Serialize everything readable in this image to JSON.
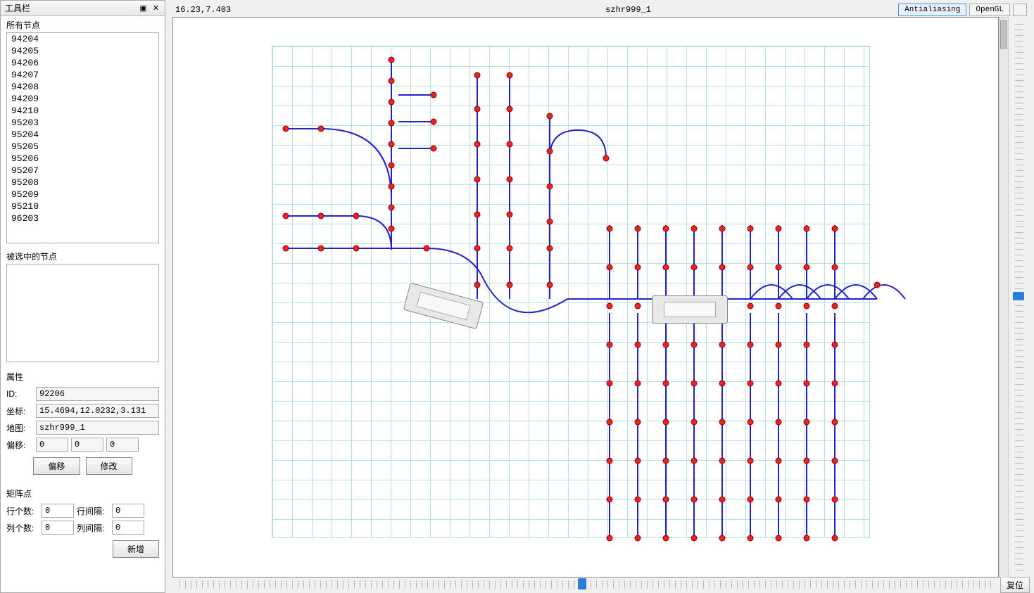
{
  "sidebar": {
    "title": "工具栏",
    "dock_icon": "▣",
    "close_icon": "✕",
    "all_nodes_label": "所有节点",
    "node_list": [
      "94204",
      "94205",
      "94206",
      "94207",
      "94208",
      "94209",
      "94210",
      "95203",
      "95204",
      "95205",
      "95206",
      "95207",
      "95208",
      "95209",
      "95210",
      "96203"
    ],
    "selected_label": "被选中的节点",
    "prop_label": "属性",
    "id_label": "ID:",
    "id_value": "92206",
    "coord_label": "坐标:",
    "coord_value": "15.4694,12.0232,3.131",
    "map_label": "地图:",
    "map_value": "szhr999_1",
    "offset_label": "偏移:",
    "offset_x": "0",
    "offset_y": "0",
    "offset_z": "0",
    "btn_offset": "偏移",
    "btn_modify": "修改",
    "matrix_label": "矩阵点",
    "row_count_label": "行个数:",
    "row_count": "0",
    "row_gap_label": "行间隔:",
    "row_gap": "0",
    "col_count_label": "列个数:",
    "col_count": "0",
    "col_gap_label": "列间隔:",
    "col_gap": "0",
    "btn_add": "新增"
  },
  "header": {
    "cursor_coord": "16.23,7.403",
    "file_name": "szhr999_1",
    "btn_aa": "Antialiasing",
    "btn_gl": "OpenGL"
  },
  "footer": {
    "reset": "复位"
  }
}
